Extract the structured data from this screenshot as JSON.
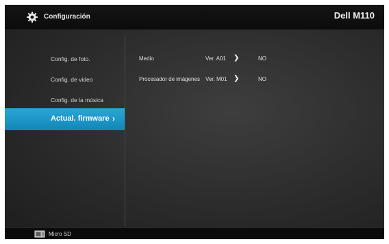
{
  "header": {
    "title": "Configuración",
    "model": "Dell M110",
    "icon": "gear-icon"
  },
  "sidebar": {
    "items": [
      {
        "label": "Config. de foto."
      },
      {
        "label": "Config. de video"
      },
      {
        "label": "Config. de la música"
      },
      {
        "label": "Actual. firmware",
        "active": true,
        "chevron": "›"
      }
    ]
  },
  "firmware": {
    "rows": [
      {
        "name": "Medio",
        "version": "Ver. A01",
        "status": "NO"
      },
      {
        "name": "Procesador de imágenes",
        "version": "Ver. M01",
        "status": "NO"
      }
    ]
  },
  "footer": {
    "label": "Micro SD",
    "icon": "micro-sd-icon"
  },
  "colors": {
    "accent": "#1e98c8",
    "background": "#2e2e2e",
    "header": "#101010"
  }
}
